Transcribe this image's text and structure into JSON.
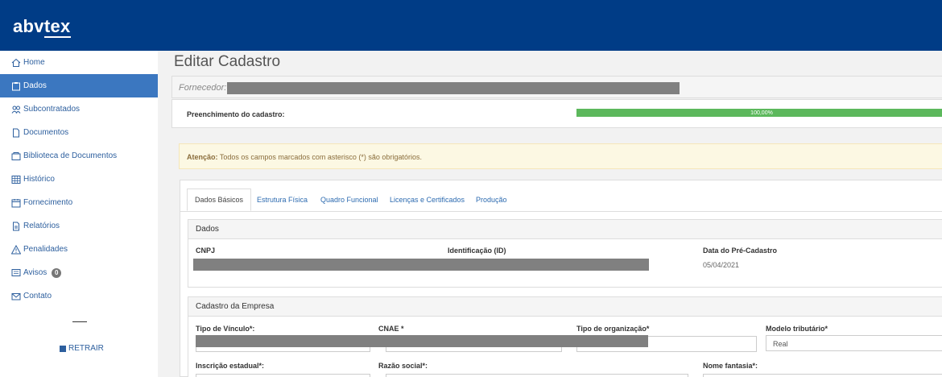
{
  "brand": {
    "logo_prefix": "abv",
    "logo_underlined": "tex"
  },
  "sidebar": {
    "items": [
      {
        "label": "Home",
        "icon": "home-icon"
      },
      {
        "label": "Dados",
        "icon": "clipboard-icon",
        "active": true
      },
      {
        "label": "Subcontratados",
        "icon": "users-icon"
      },
      {
        "label": "Documentos",
        "icon": "document-icon"
      },
      {
        "label": "Biblioteca de Documentos",
        "icon": "archive-icon"
      },
      {
        "label": "Histórico",
        "icon": "grid-icon"
      },
      {
        "label": "Fornecimento",
        "icon": "calendar-icon"
      },
      {
        "label": "Relatórios",
        "icon": "report-icon"
      },
      {
        "label": "Penalidades",
        "icon": "warning-icon"
      },
      {
        "label": "Avisos",
        "icon": "message-icon",
        "badge": "0"
      },
      {
        "label": "Contato",
        "icon": "mail-icon"
      }
    ],
    "collapse_label": "RETRAIR"
  },
  "page": {
    "title": "Editar Cadastro",
    "fornecedor_label": "Fornecedor:",
    "preenchimento_label": "Preenchimento do cadastro:",
    "progress": {
      "value": 100,
      "text": "100,00%",
      "color": "#5cb85c"
    },
    "alert": {
      "strong": "Atenção:",
      "text": " Todos os campos marcados com asterisco (*) são obrigatórios."
    }
  },
  "tabs": [
    "Dados Básicos",
    "Estrutura Física",
    "Quadro Funcional",
    "Licenças e Certificados",
    "Produção"
  ],
  "dados": {
    "title": "Dados",
    "cnpj_label": "CNPJ",
    "id_label": "Identificação (ID)",
    "data_label": "Data do Pré-Cadastro",
    "data_value": "05/04/2021"
  },
  "cadastro": {
    "title": "Cadastro da Empresa",
    "tipo_vinculo_label": "Tipo de Vínculo*:",
    "cnae_label": "CNAE *",
    "tipo_org_label": "Tipo de organização*",
    "modelo_label": "Modelo tributário*",
    "modelo_value": "Real",
    "insc_estadual_label": "Inscrição estadual*:",
    "razao_social_label": "Razão social*:",
    "nome_fantasia_label": "Nome fantasia*:"
  },
  "colors": {
    "topbar": "#003c86",
    "active_nav": "#3b77c0",
    "link": "#2d5f9e"
  }
}
